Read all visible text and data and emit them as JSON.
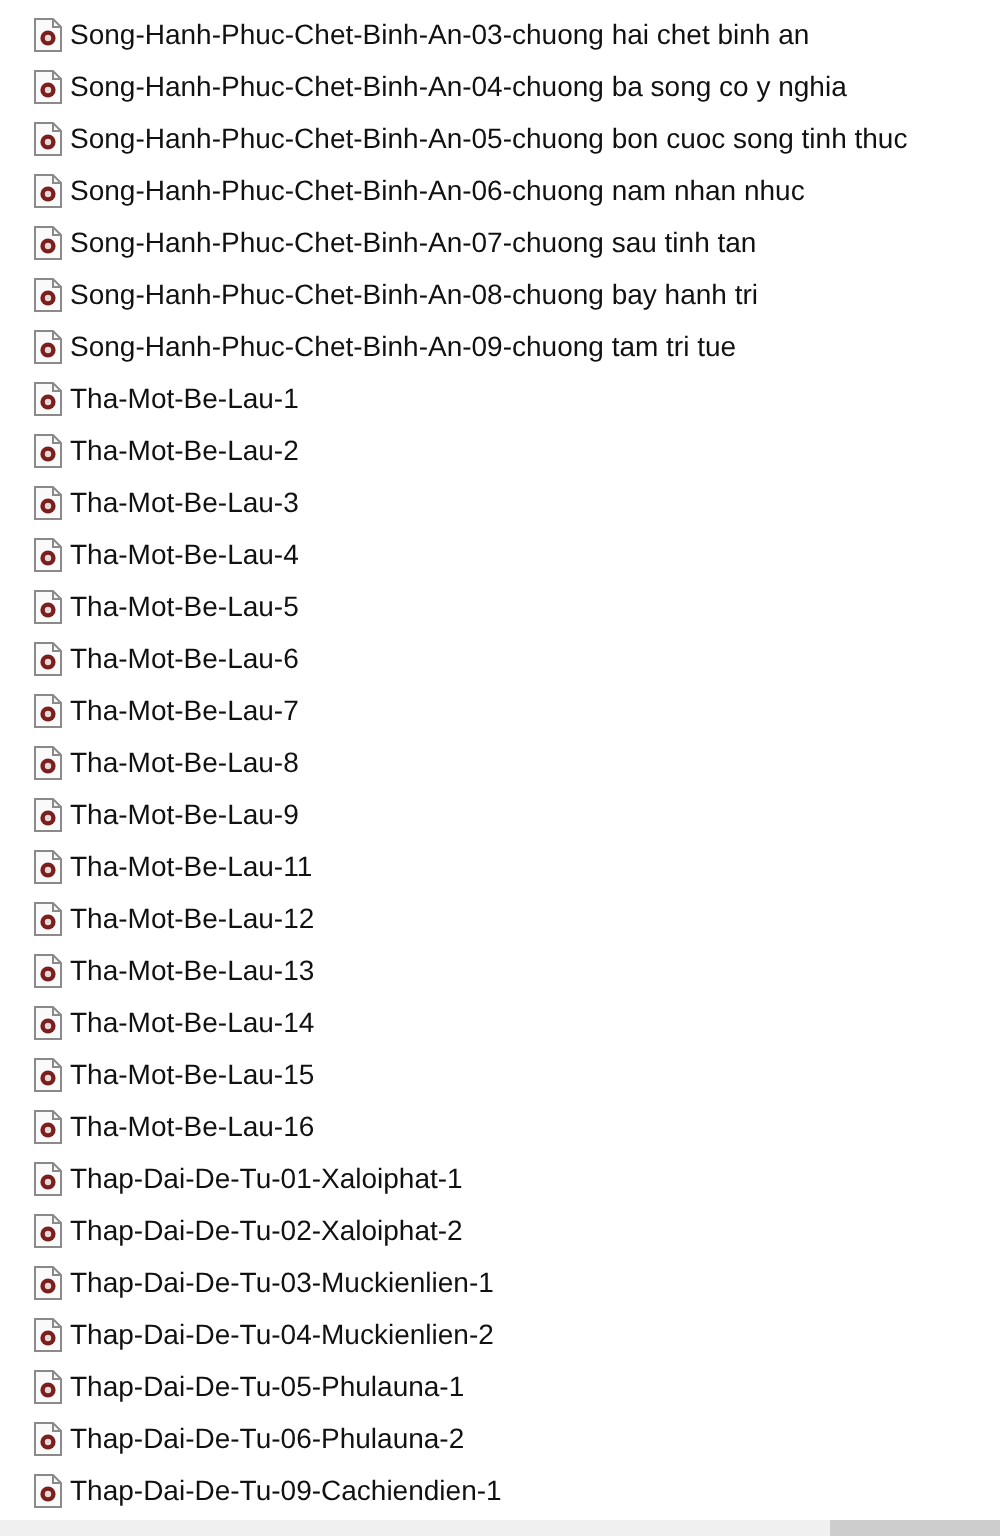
{
  "files": [
    {
      "name": "Song-Hanh-Phuc-Chet-Binh-An-03-chuong hai chet binh an"
    },
    {
      "name": "Song-Hanh-Phuc-Chet-Binh-An-04-chuong ba song co y nghia"
    },
    {
      "name": "Song-Hanh-Phuc-Chet-Binh-An-05-chuong bon cuoc song tinh thuc"
    },
    {
      "name": "Song-Hanh-Phuc-Chet-Binh-An-06-chuong nam nhan nhuc"
    },
    {
      "name": "Song-Hanh-Phuc-Chet-Binh-An-07-chuong sau tinh tan"
    },
    {
      "name": "Song-Hanh-Phuc-Chet-Binh-An-08-chuong bay hanh tri"
    },
    {
      "name": "Song-Hanh-Phuc-Chet-Binh-An-09-chuong tam tri tue"
    },
    {
      "name": "Tha-Mot-Be-Lau-1"
    },
    {
      "name": "Tha-Mot-Be-Lau-2"
    },
    {
      "name": "Tha-Mot-Be-Lau-3"
    },
    {
      "name": "Tha-Mot-Be-Lau-4"
    },
    {
      "name": "Tha-Mot-Be-Lau-5"
    },
    {
      "name": "Tha-Mot-Be-Lau-6"
    },
    {
      "name": "Tha-Mot-Be-Lau-7"
    },
    {
      "name": "Tha-Mot-Be-Lau-8"
    },
    {
      "name": "Tha-Mot-Be-Lau-9"
    },
    {
      "name": "Tha-Mot-Be-Lau-11"
    },
    {
      "name": "Tha-Mot-Be-Lau-12"
    },
    {
      "name": "Tha-Mot-Be-Lau-13"
    },
    {
      "name": "Tha-Mot-Be-Lau-14"
    },
    {
      "name": "Tha-Mot-Be-Lau-15"
    },
    {
      "name": "Tha-Mot-Be-Lau-16"
    },
    {
      "name": "Thap-Dai-De-Tu-01-Xaloiphat-1"
    },
    {
      "name": "Thap-Dai-De-Tu-02-Xaloiphat-2"
    },
    {
      "name": "Thap-Dai-De-Tu-03-Muckienlien-1"
    },
    {
      "name": "Thap-Dai-De-Tu-04-Muckienlien-2"
    },
    {
      "name": "Thap-Dai-De-Tu-05-Phulauna-1"
    },
    {
      "name": "Thap-Dai-De-Tu-06-Phulauna-2"
    },
    {
      "name": "Thap-Dai-De-Tu-09-Cachiendien-1"
    }
  ]
}
